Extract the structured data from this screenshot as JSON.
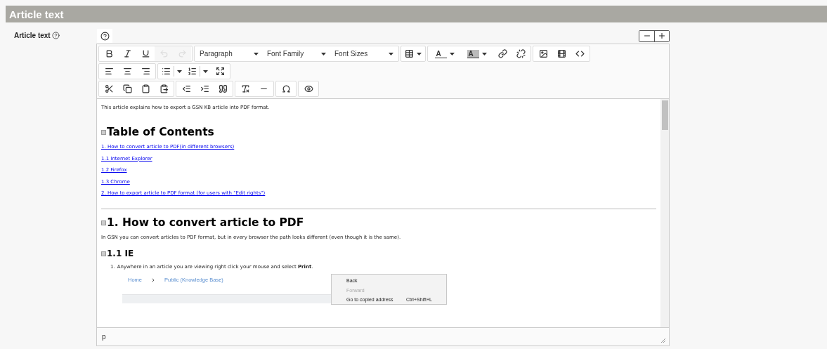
{
  "section": {
    "title": "Article text"
  },
  "field": {
    "label": "Article text"
  },
  "toolbar": {
    "rows": [
      [
        [
          {
            "kind": "button",
            "disabled": false
          },
          {
            "kind": "button",
            "disabled": false
          },
          {
            "kind": "button",
            "disabled": false
          },
          {
            "kind": "button",
            "disabled": true
          },
          {
            "kind": "button",
            "disabled": true
          }
        ],
        [
          {
            "kind": "dropdown",
            "label": "Paragraph"
          },
          {
            "kind": "dropdown",
            "label": "Font Family"
          },
          {
            "kind": "dropdown",
            "label": "Font Sizes"
          }
        ],
        [
          {
            "kind": "menu",
            "disabled": false
          }
        ],
        [
          {
            "kind": "color",
            "label": "A",
            "highlight": false
          },
          {
            "kind": "color",
            "label": "A",
            "highlight": true
          },
          {
            "kind": "button",
            "disabled": false
          },
          {
            "kind": "button",
            "disabled": false
          }
        ],
        [
          {
            "kind": "button",
            "disabled": false
          },
          {
            "kind": "button",
            "disabled": false
          },
          {
            "kind": "button",
            "disabled": false
          }
        ]
      ],
      [
        [
          {
            "kind": "button",
            "disabled": false
          },
          {
            "kind": "button",
            "disabled": false
          },
          {
            "kind": "button",
            "disabled": false
          }
        ],
        [
          {
            "kind": "split",
            "disabled": false
          },
          {
            "kind": "split",
            "disabled": false
          },
          {
            "kind": "button",
            "disabled": false
          }
        ]
      ],
      [
        [
          {
            "kind": "button",
            "disabled": false
          },
          {
            "kind": "button",
            "disabled": false
          },
          {
            "kind": "button",
            "disabled": false
          },
          {
            "kind": "button",
            "disabled": false
          }
        ],
        [
          {
            "kind": "button",
            "disabled": false
          },
          {
            "kind": "button",
            "disabled": false
          },
          {
            "kind": "button",
            "disabled": false
          }
        ],
        [
          {
            "kind": "button",
            "disabled": false
          },
          {
            "kind": "button",
            "disabled": false
          }
        ],
        [
          {
            "kind": "button",
            "disabled": false
          }
        ],
        [
          {
            "kind": "button",
            "disabled": false
          }
        ]
      ]
    ]
  },
  "content": [
    {
      "kind": "p",
      "text": "This article explains how to export a GSN KB article into PDF format."
    },
    {
      "kind": "h1",
      "text": "Table of Contents"
    },
    {
      "kind": "link",
      "text": "1. How to convert article to PDF(in different browsers)"
    },
    {
      "kind": "link",
      "text": "1.1 Internet Explorer"
    },
    {
      "kind": "link",
      "text": "1.2 Firefox"
    },
    {
      "kind": "link",
      "text": "1.3 Chrome"
    },
    {
      "kind": "link",
      "text": "2. How to export article to PDF format (for users with \"Edit rights\")"
    },
    {
      "kind": "hr"
    },
    {
      "kind": "h1",
      "text": "1. How to convert article to PDF"
    },
    {
      "kind": "p",
      "text": "In GSN you can convert articles to PDF format, but in every browser the path looks different (even though it is the same)."
    },
    {
      "kind": "h2",
      "text": "1.1 IE"
    },
    {
      "kind": "li",
      "number": "1.",
      "text": "Anywhere in an article you are viewing right click your mouse and select **Print**."
    },
    {
      "kind": "screenshot",
      "breadcrumb": [
        "Home",
        "Public (Knowledge Base)"
      ],
      "menu": [
        {
          "label": "Back",
          "disabled": false
        },
        {
          "label": "Forward",
          "disabled": true
        },
        {
          "label": "Go to copied address",
          "shortcut": "Ctrl+Shift+L",
          "disabled": false
        }
      ]
    }
  ],
  "status_bar": {
    "path": "p"
  }
}
